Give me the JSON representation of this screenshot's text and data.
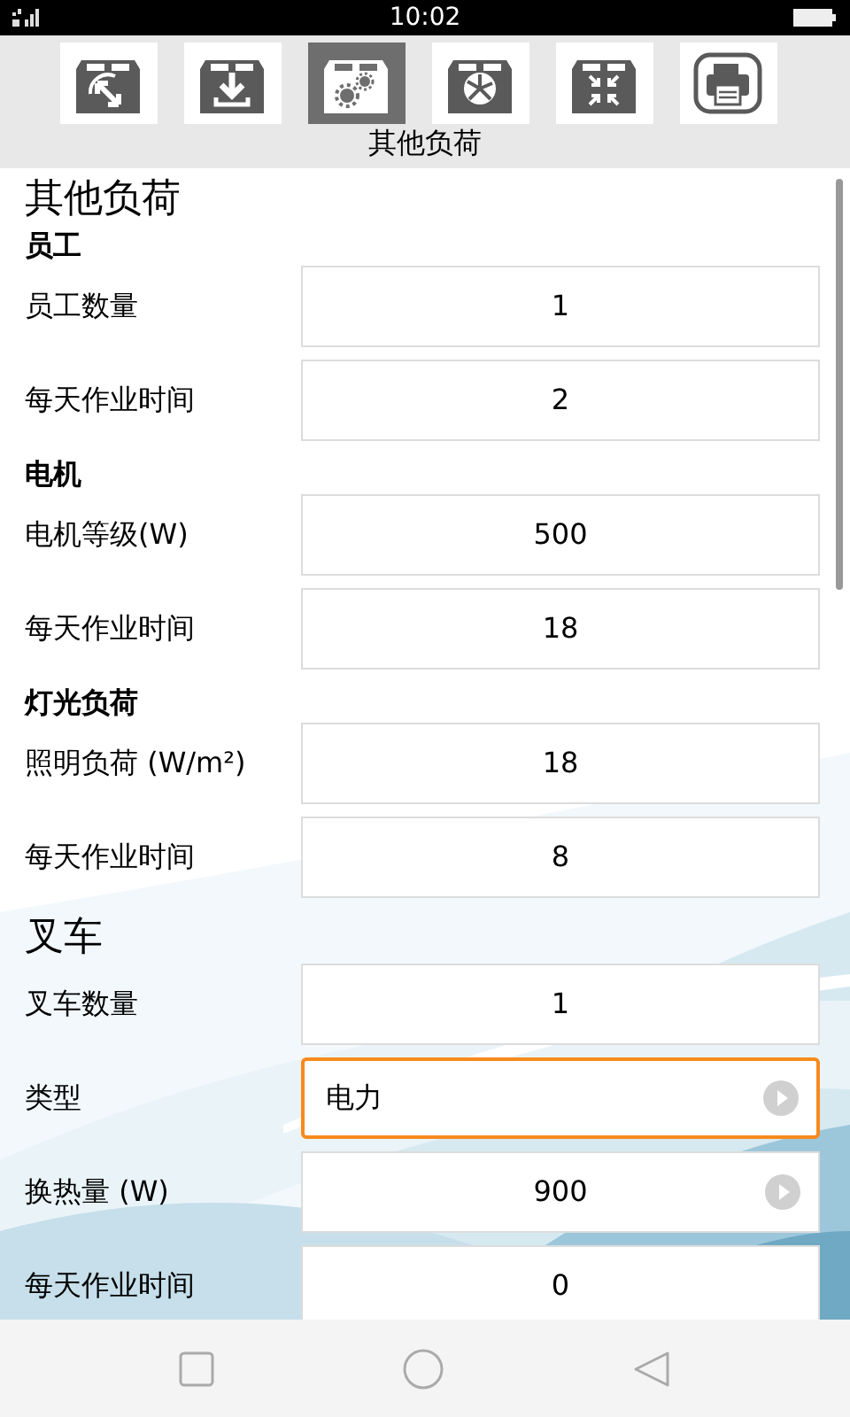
{
  "status_bar": {
    "time": "10:02"
  },
  "toolbar": {
    "tabs": [
      {
        "selected": false
      },
      {
        "selected": false
      },
      {
        "selected": true
      },
      {
        "selected": false
      },
      {
        "selected": false
      },
      {
        "selected": false
      }
    ],
    "title": "其他负荷"
  },
  "form": [
    {
      "kind": "title",
      "text": "其他负荷"
    },
    {
      "kind": "heading",
      "text": "员工"
    },
    {
      "kind": "field",
      "label": "员工数量",
      "value": "1"
    },
    {
      "kind": "field",
      "label": "每天作业时间",
      "value": "2"
    },
    {
      "kind": "heading",
      "text": "电机"
    },
    {
      "kind": "field",
      "label": "电机等级(W)",
      "value": "500"
    },
    {
      "kind": "field",
      "label": "每天作业时间",
      "value": "18"
    },
    {
      "kind": "heading",
      "text": "灯光负荷"
    },
    {
      "kind": "field",
      "label": "照明负荷 (W/m²)",
      "value": "18"
    },
    {
      "kind": "field",
      "label": "每天作业时间",
      "value": "8"
    },
    {
      "kind": "title",
      "text": "叉车"
    },
    {
      "kind": "field",
      "label": "叉车数量",
      "value": "1"
    },
    {
      "kind": "select",
      "label": "类型",
      "value": "电力",
      "focused": true
    },
    {
      "kind": "picker",
      "label": "换热量 (W)",
      "value": "900",
      "focused": false
    },
    {
      "kind": "field",
      "label": "每天作业时间",
      "value": "0"
    }
  ]
}
